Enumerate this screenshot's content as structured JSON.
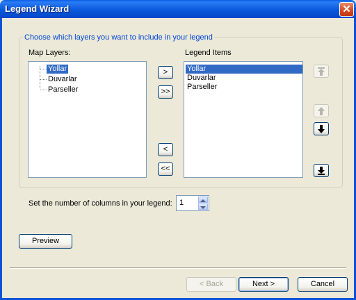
{
  "window": {
    "title": "Legend Wizard",
    "close_glyph": "✕"
  },
  "group": {
    "label": "Choose which layers you want to include in your legend"
  },
  "map_layers": {
    "label": "Map Layers:",
    "items": [
      {
        "label": "Yollar",
        "selected": true
      },
      {
        "label": "Duvarlar",
        "selected": false
      },
      {
        "label": "Parseller",
        "selected": false
      }
    ]
  },
  "legend_items": {
    "label": "Legend Items",
    "items": [
      {
        "label": "Yollar",
        "selected": true
      },
      {
        "label": "Duvarlar",
        "selected": false
      },
      {
        "label": "Parseller",
        "selected": false
      }
    ]
  },
  "transfer_buttons": {
    "add": ">",
    "add_all": ">>",
    "remove": "<",
    "remove_all": "<<"
  },
  "order_buttons": {
    "to_top": {
      "icon": "arrow-to-top-icon",
      "enabled": false
    },
    "up": {
      "icon": "arrow-up-icon",
      "enabled": false
    },
    "down": {
      "icon": "arrow-down-icon",
      "enabled": true
    },
    "to_bottom": {
      "icon": "arrow-to-bottom-icon",
      "enabled": true
    }
  },
  "columns": {
    "label": "Set the number of columns in your legend:",
    "value": "1"
  },
  "buttons": {
    "preview": "Preview",
    "back": "< Back",
    "next": "Next >",
    "cancel": "Cancel"
  },
  "colors": {
    "titlebar": "#0a58dc",
    "selection": "#316ac5",
    "group_label": "#0046d5",
    "background": "#ece9d8"
  }
}
